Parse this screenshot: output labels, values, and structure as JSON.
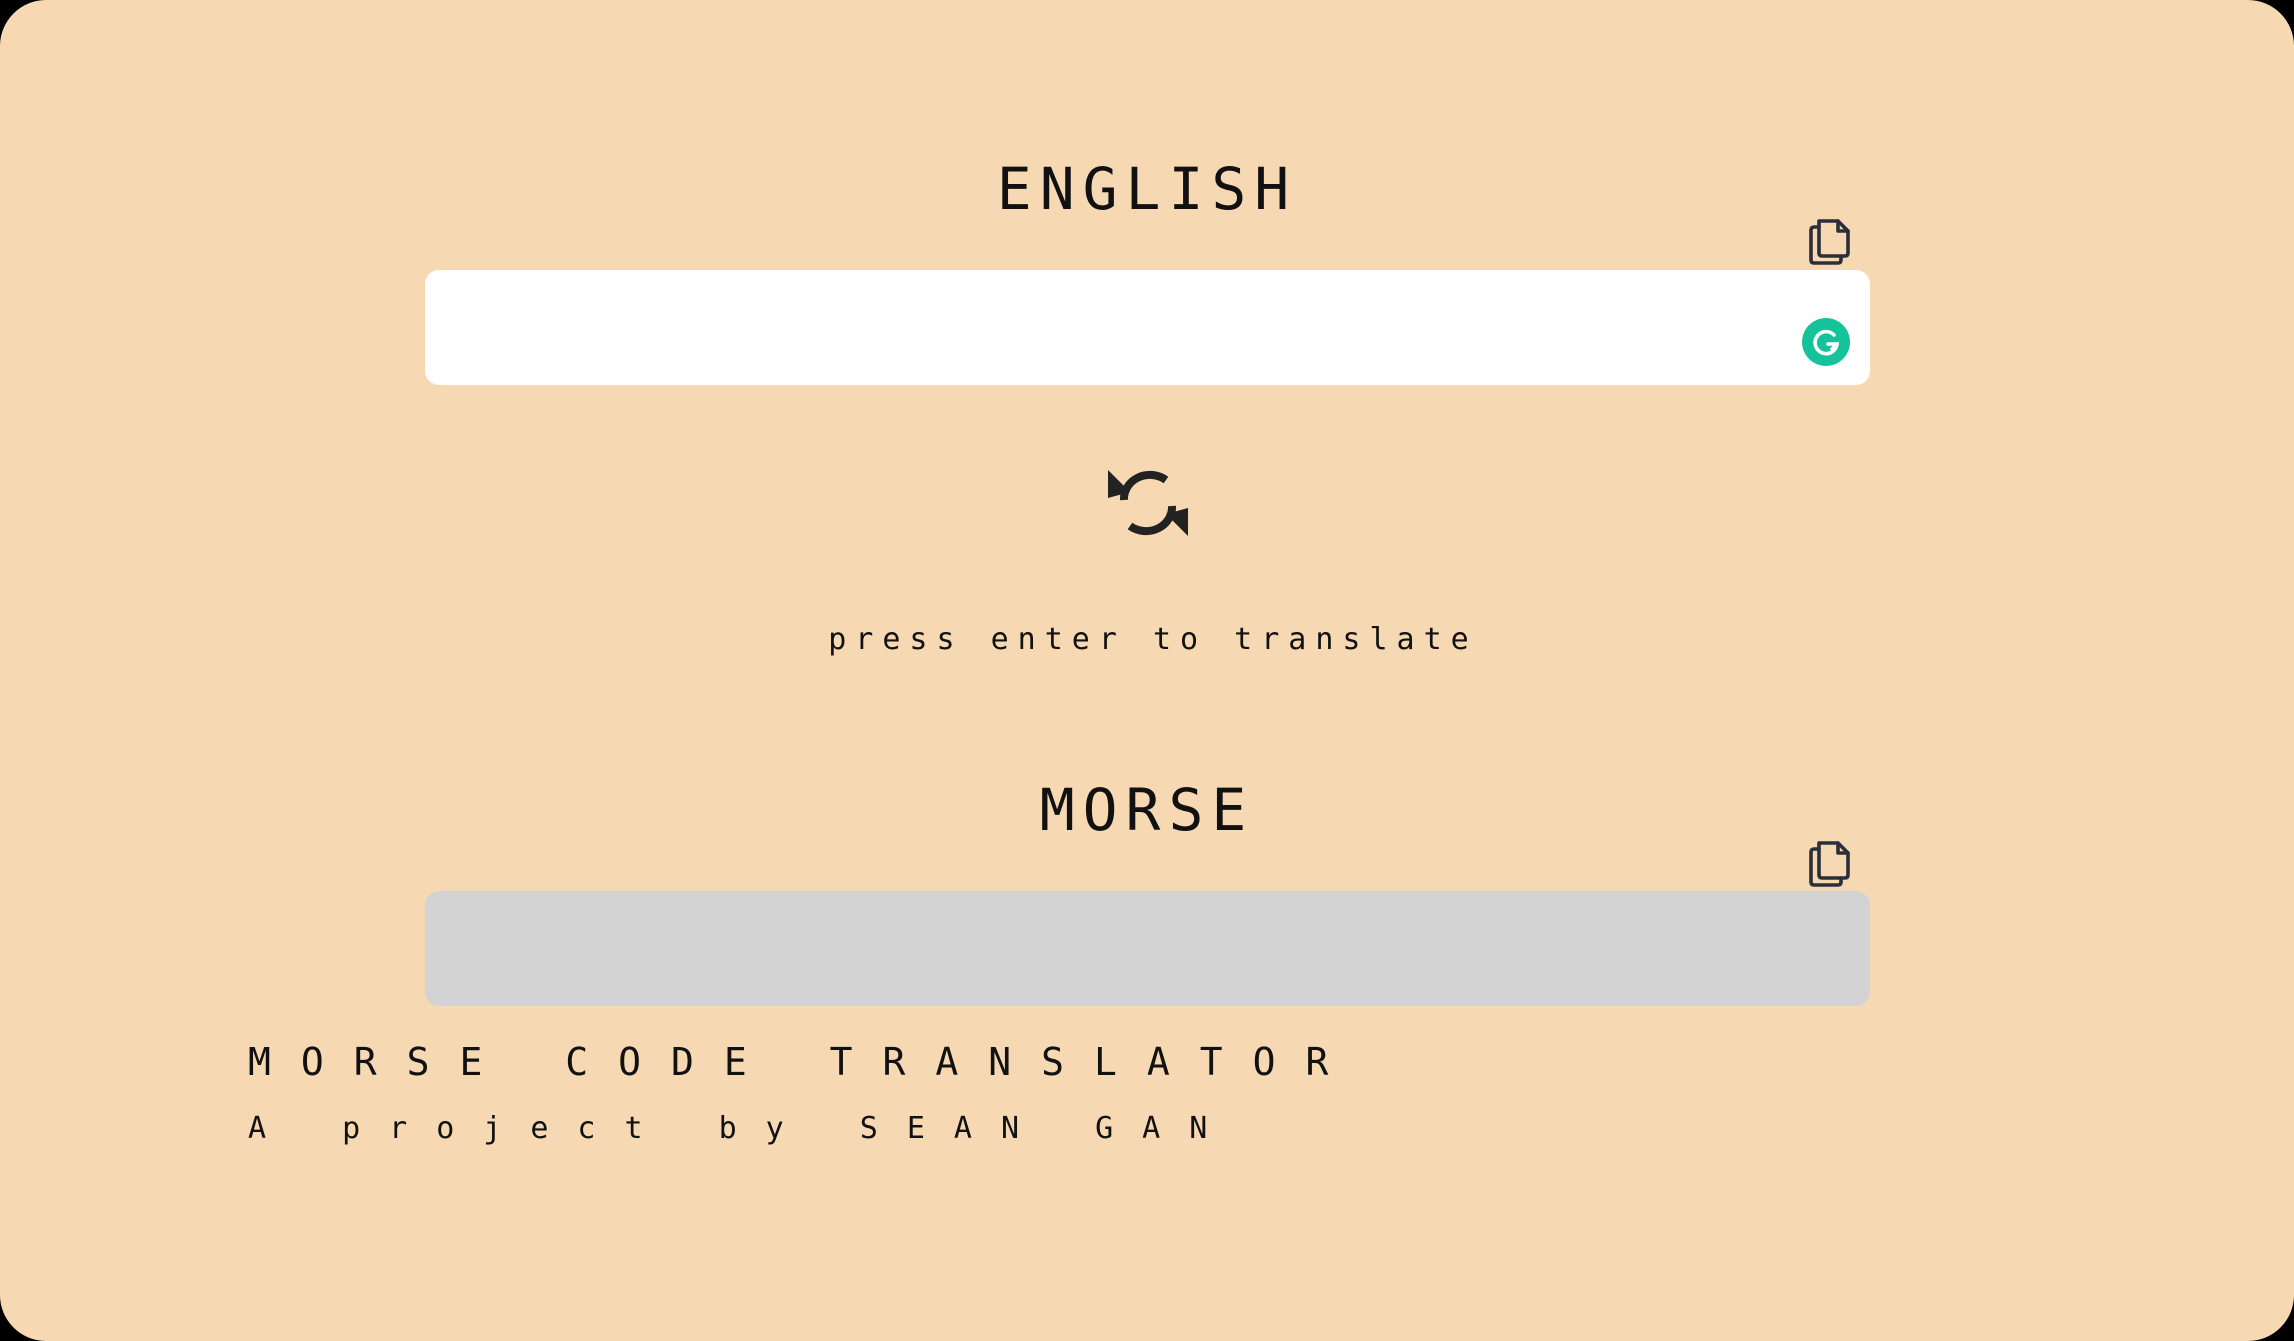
{
  "colors": {
    "page_background": "#f6d9b3",
    "input_background": "#ffffff",
    "output_background": "#d3d3d3",
    "text": "#111111",
    "grammarly_green": "#15c39a"
  },
  "english": {
    "heading": "ENGLISH",
    "copy_icon": "copy-icon",
    "input_value": "",
    "grammarly_icon": "grammarly-icon"
  },
  "swap": {
    "icon": "swap-arrows-icon"
  },
  "hint": {
    "text": "press enter to translate"
  },
  "morse": {
    "heading": "MORSE",
    "copy_icon": "copy-icon",
    "output_value": ""
  },
  "footer": {
    "title": "MORSE CODE TRANSLATOR",
    "subtitle": "A project by SEAN GAN"
  }
}
